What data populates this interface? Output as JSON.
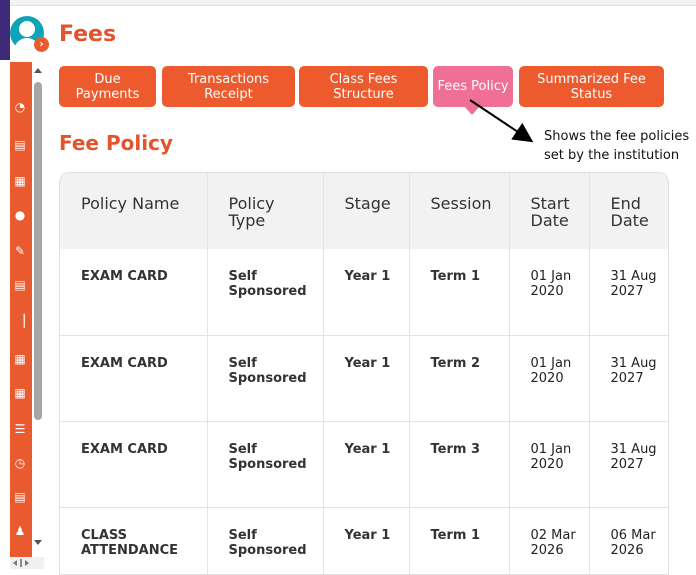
{
  "page": {
    "title": "Fees"
  },
  "tabs": [
    {
      "label": "Due Payments",
      "active": false
    },
    {
      "label": "Transactions Receipt",
      "active": false
    },
    {
      "label": "Class Fees Structure",
      "active": false
    },
    {
      "label": "Fees Policy",
      "active": true
    },
    {
      "label": "Summarized Fee Status",
      "active": false
    }
  ],
  "section": {
    "title": "Fee Policy"
  },
  "annotation": {
    "text": "Shows the fee policies set by the institution"
  },
  "sidebar": {
    "toggle_glyph": "›"
  },
  "table": {
    "columns": [
      "Policy Name",
      "Policy Type",
      "Stage",
      "Session",
      "Start Date",
      "End Date"
    ],
    "rows": [
      [
        "EXAM CARD",
        "Self Sponsored",
        "Year 1",
        "Term 1",
        "01 Jan 2020",
        "31 Aug 2027"
      ],
      [
        "EXAM CARD",
        "Self Sponsored",
        "Year 1",
        "Term 2",
        "01 Jan 2020",
        "31 Aug 2027"
      ],
      [
        "EXAM CARD",
        "Self Sponsored",
        "Year 1",
        "Term 3",
        "01 Jan 2020",
        "31 Aug 2027"
      ],
      [
        "CLASS ATTENDANCE",
        "Self Sponsored",
        "Year 1",
        "Term 1",
        "02 Mar 2026",
        "06 Mar 2026"
      ]
    ]
  },
  "colors": {
    "accent": "#ea5a2f",
    "active_tab": "#ef6f96",
    "title": "#e5532b",
    "avatar": "#0fa3b8"
  }
}
